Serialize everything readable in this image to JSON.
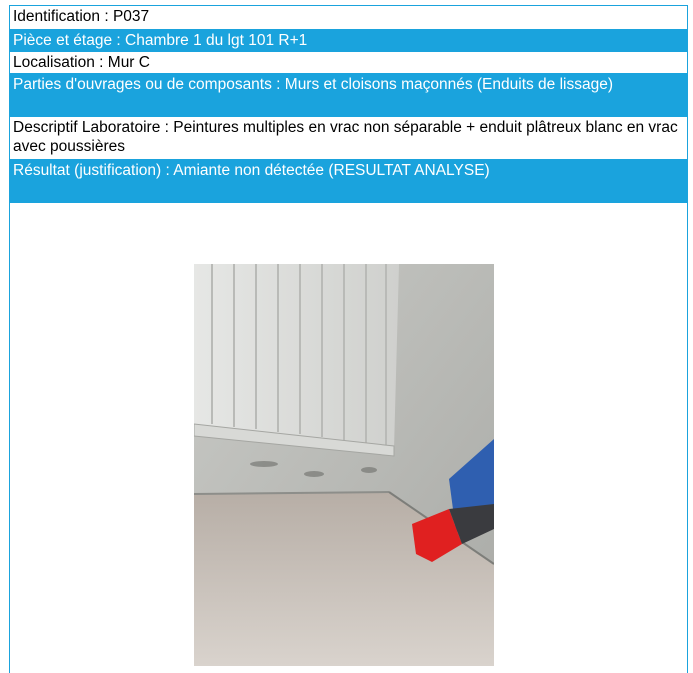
{
  "colors": {
    "accent": "#1aa3dd"
  },
  "fields": {
    "identification": "Identification : P037",
    "piece_etage": "Pièce et étage : Chambre 1 du lgt 101 R+1",
    "localisation": "Localisation : Mur C",
    "parties": "Parties d'ouvrages ou de composants : Murs et cloisons maçonnés (Enduits de lissage)",
    "descriptif": "Descriptif Laboratoire : Peintures multiples en vrac non séparable + enduit plâtreux blanc en vrac avec poussières",
    "resultat": "Résultat (justification) : Amiante non détectée (RESULTAT ANALYSE)"
  },
  "photo": {
    "subject": "radiator-above-floor-photo"
  }
}
